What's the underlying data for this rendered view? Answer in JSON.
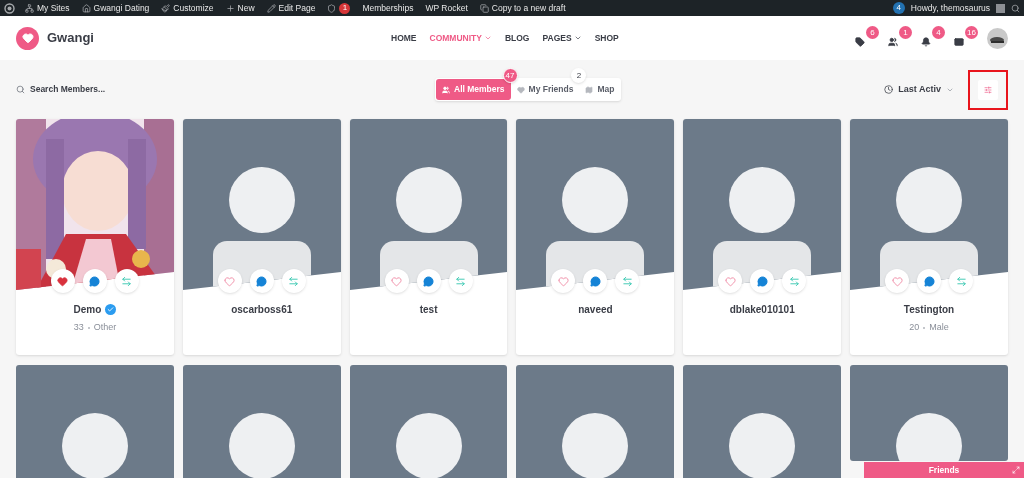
{
  "admin_bar": {
    "items": [
      {
        "label": "My Sites"
      },
      {
        "label": "Gwangi Dating"
      },
      {
        "label": "Customize"
      },
      {
        "label": "New"
      },
      {
        "label": "Edit Page"
      },
      {
        "badge": "1"
      },
      {
        "label": "Memberships"
      },
      {
        "label": "WP Rocket"
      },
      {
        "label": "Copy to a new draft"
      }
    ],
    "notification_count": "4",
    "greeting": "Howdy, themosaurus"
  },
  "header": {
    "logo": "Gwangi",
    "nav": [
      {
        "label": "HOME",
        "selected": false,
        "dropdown": false
      },
      {
        "label": "COMMUNITY",
        "selected": true,
        "dropdown": true
      },
      {
        "label": "BLOG",
        "selected": false,
        "dropdown": false
      },
      {
        "label": "PAGES",
        "selected": false,
        "dropdown": true
      },
      {
        "label": "SHOP",
        "selected": false,
        "dropdown": false
      }
    ],
    "notifications": [
      "6",
      "1",
      "4",
      "16"
    ]
  },
  "toolbar": {
    "search": {
      "placeholder": "Search Members..."
    },
    "tabs": [
      {
        "label": "All Members",
        "selected": true,
        "badge": "47"
      },
      {
        "label": "My Friends",
        "selected": false,
        "badge": "2"
      },
      {
        "label": "Map",
        "selected": false
      }
    ],
    "sort": {
      "label": "Last Activ"
    },
    "filter_button": {
      "highlighted": true
    }
  },
  "members": [
    {
      "name": "Demo",
      "verified": true,
      "liked": true,
      "age": "33",
      "gender": "Other"
    },
    {
      "kind": "placeholder",
      "name": "oscarboss61",
      "verified": false,
      "liked": false
    },
    {
      "kind": "placeholder",
      "name": "test",
      "verified": false,
      "liked": false
    },
    {
      "kind": "placeholder",
      "name": "naveed",
      "verified": false,
      "liked": false
    },
    {
      "kind": "placeholder",
      "name": "dblake010101",
      "verified": false,
      "liked": false
    },
    {
      "kind": "placeholder",
      "name": "Testington",
      "verified": false,
      "liked": false,
      "age": "20",
      "gender": "Male"
    }
  ],
  "second_row": [
    {
      "kind": "placeholder"
    },
    {
      "kind": "placeholder"
    },
    {
      "kind": "placeholder"
    },
    {
      "kind": "placeholder"
    },
    {
      "kind": "placeholder"
    },
    {
      "kind": "placeholder"
    }
  ],
  "chat_bar": {
    "title": "Friends"
  }
}
